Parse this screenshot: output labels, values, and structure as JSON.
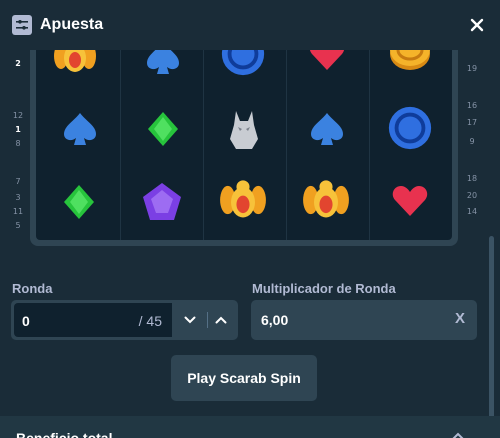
{
  "header": {
    "title": "Apuesta",
    "icon": "sliders-icon",
    "close_icon": "close-icon"
  },
  "left_numbers": [
    "2",
    "12",
    "1",
    "8",
    "7",
    "3",
    "11",
    "5"
  ],
  "right_numbers": [
    "19",
    "16",
    "17",
    "9",
    "18",
    "20",
    "14"
  ],
  "board": {
    "rows": [
      [
        "scarab",
        "spade",
        "orb",
        "heart",
        "coin"
      ],
      [
        "spade",
        "diamond",
        "wolf",
        "spade",
        "orb"
      ],
      [
        "diamond",
        "gem",
        "scarab",
        "scarab",
        "heart"
      ]
    ]
  },
  "ronda": {
    "label": "Ronda",
    "value": "0",
    "max": "/ 45"
  },
  "multiplicador": {
    "label": "Multiplicador de Ronda",
    "value": "6,00",
    "suffix": "X"
  },
  "play_button": {
    "label": "Play Scarab Spin"
  },
  "footer": {
    "text": "Beneficio total"
  },
  "colors": {
    "bg": "#1a2c38",
    "panel": "#2f4553",
    "board": "#0f212e",
    "muted": "#b1bad3"
  }
}
